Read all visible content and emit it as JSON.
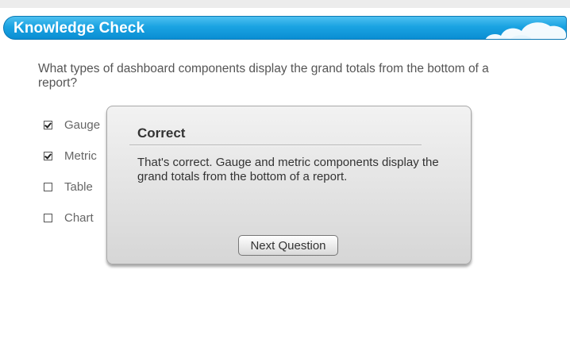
{
  "header": {
    "title": "Knowledge Check",
    "color": "#1aa3e2"
  },
  "question": {
    "text": "What types of dashboard components display the grand totals from the bottom of a report?"
  },
  "options": [
    {
      "label": "Gauge",
      "checked": true
    },
    {
      "label": "Metric",
      "checked": true
    },
    {
      "label": "Table",
      "checked": false
    },
    {
      "label": "Chart",
      "checked": false
    }
  ],
  "feedback": {
    "title": "Correct",
    "message": "That's correct. Gauge and metric components display the grand totals from the bottom of a report.",
    "button_label": "Next Question"
  }
}
